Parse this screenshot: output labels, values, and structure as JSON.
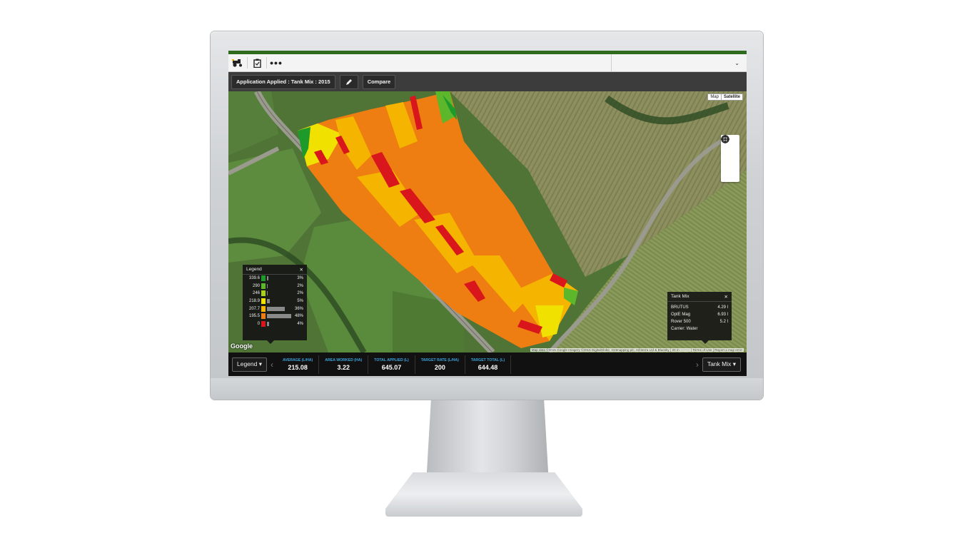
{
  "toolbar": {
    "icons": [
      "tractor-icon",
      "clipboard-icon",
      "more-icon"
    ],
    "more_label": "•••",
    "dropdown_label": "⌄"
  },
  "subbar": {
    "layer_label": "Application Applied : Tank Mix : 2015",
    "compare_label": "Compare",
    "edit_icon": "pencil-icon"
  },
  "map": {
    "map_type": {
      "options": [
        "Map",
        "Satellite"
      ],
      "selected": "Satellite"
    },
    "zoom": {
      "locate": "locate-icon",
      "in": "zoom-in-icon",
      "out": "zoom-out-icon"
    },
    "logo": "Google",
    "attribution": "Map data ©2015 Google Imagery ©2015 DigitalGlobe, Getmapping plc, Infoterra Ltd & Bluesky | 20 m ——— | Terms of Use | Report a map error"
  },
  "legend": {
    "title": "Legend",
    "close": "✕",
    "rows": [
      {
        "value": "339.6",
        "pct": "3%",
        "share": 3,
        "color": "#1e9a2b"
      },
      {
        "value": "290",
        "pct": "2%",
        "share": 2,
        "color": "#5cb82a"
      },
      {
        "value": "246",
        "pct": "2%",
        "share": 2,
        "color": "#a6cf1e"
      },
      {
        "value": "218.9",
        "pct": "5%",
        "share": 5,
        "color": "#f1e100"
      },
      {
        "value": "207.7",
        "pct": "36%",
        "share": 36,
        "color": "#f4b400"
      },
      {
        "value": "195.5",
        "pct": "48%",
        "share": 48,
        "color": "#ee7d12"
      },
      {
        "value": "0",
        "pct": "4%",
        "share": 4,
        "color": "#d8161b"
      }
    ]
  },
  "tankmix": {
    "title": "Tank Mix",
    "close": "✕",
    "rows": [
      {
        "name": "BRUTUS",
        "value": "4.29 l"
      },
      {
        "name": "OptE Mag",
        "value": "6.93 l"
      },
      {
        "name": "Rover 500",
        "value": "5.2 l"
      }
    ],
    "carrier": "Carrier: Water"
  },
  "bottombar": {
    "legend_dropdown": "Legend ▾",
    "tankmix_dropdown": "Tank Mix ▾",
    "prev": "‹",
    "next": "›",
    "stats": [
      {
        "label": "AVERAGE (L/HA)",
        "value": "215.08"
      },
      {
        "label": "AREA WORKED (HA)",
        "value": "3.22"
      },
      {
        "label": "TOTAL APPLIED (L)",
        "value": "645.07"
      },
      {
        "label": "TARGET RATE (L/HA)",
        "value": "200"
      },
      {
        "label": "TARGET TOTAL (L)",
        "value": "644.48"
      }
    ]
  },
  "colors": {
    "green": "#1e9a2b",
    "yellow": "#f4b400",
    "orange": "#ee7d12",
    "red": "#d8161b",
    "accent_blue": "#3aa6e0"
  }
}
